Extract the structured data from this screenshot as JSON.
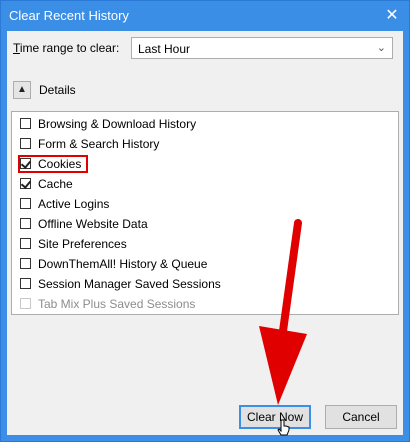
{
  "window": {
    "title": "Clear Recent History"
  },
  "time_range": {
    "label": "Time range to clear:",
    "value": "Last Hour"
  },
  "details": {
    "label": "Details"
  },
  "items": [
    {
      "label": "Browsing & Download History",
      "checked": false
    },
    {
      "label": "Form & Search History",
      "checked": false
    },
    {
      "label": "Cookies",
      "checked": true
    },
    {
      "label": "Cache",
      "checked": true
    },
    {
      "label": "Active Logins",
      "checked": false
    },
    {
      "label": "Offline Website Data",
      "checked": false
    },
    {
      "label": "Site Preferences",
      "checked": false
    },
    {
      "label": "DownThemAll! History & Queue",
      "checked": false
    },
    {
      "label": "Session Manager Saved Sessions",
      "checked": false
    },
    {
      "label": "Tab Mix Plus Saved Sessions",
      "checked": false,
      "disabled": true
    }
  ],
  "buttons": {
    "clear_now": "Clear Now",
    "cancel": "Cancel"
  },
  "colors": {
    "titlebar": "#3a8ee6",
    "highlight": "#e00000",
    "arrow": "#e00000"
  }
}
